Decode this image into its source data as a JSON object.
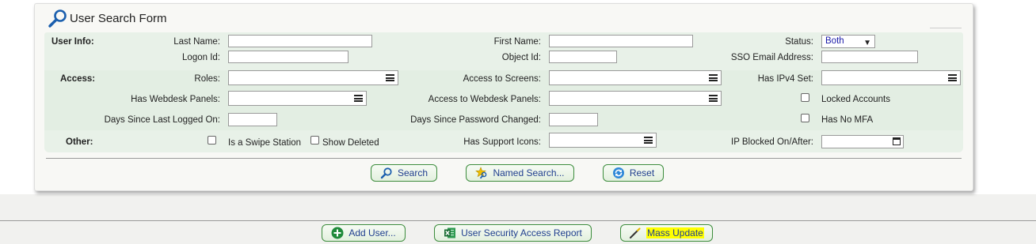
{
  "form": {
    "title": "User Search Form",
    "sections": {
      "user_info": "User Info:",
      "access": "Access:",
      "other": "Other:"
    },
    "fields": {
      "last_name": {
        "label": "Last Name:",
        "value": ""
      },
      "first_name": {
        "label": "First Name:",
        "value": ""
      },
      "status": {
        "label": "Status:",
        "value": "Both"
      },
      "logon_id": {
        "label": "Logon Id:",
        "value": ""
      },
      "object_id": {
        "label": "Object Id:",
        "value": ""
      },
      "sso_email": {
        "label": "SSO Email Address:",
        "value": ""
      },
      "roles": {
        "label": "Roles:"
      },
      "access_screens": {
        "label": "Access to Screens:"
      },
      "has_ipv4": {
        "label": "Has IPv4 Set:"
      },
      "webdesk_panels": {
        "label": "Has Webdesk Panels:"
      },
      "access_webdesk_panels": {
        "label": "Access to Webdesk Panels:"
      },
      "locked_accounts": {
        "label": "Locked Accounts",
        "checked": false
      },
      "days_logged_on": {
        "label": "Days Since Last Logged On:",
        "value": ""
      },
      "days_pw_changed": {
        "label": "Days Since Password Changed:",
        "value": ""
      },
      "has_no_mfa": {
        "label": "Has No MFA",
        "checked": false
      },
      "swipe_station": {
        "label": "Is a Swipe Station",
        "checked": false
      },
      "show_deleted": {
        "label": "Show Deleted",
        "checked": false
      },
      "support_icons": {
        "label": "Has Support Icons:"
      },
      "ip_blocked": {
        "label": "IP Blocked On/After:",
        "value": ""
      }
    },
    "buttons": {
      "search": "Search",
      "named_search": "Named Search...",
      "reset": "Reset"
    }
  },
  "footer_buttons": {
    "add_user": "Add User...",
    "security_report": "User Security Access Report",
    "mass_update": "Mass Update"
  },
  "colors": {
    "accent_green": "#3c8c3c",
    "link_blue": "#203f8f",
    "band_green": "#e8f1e8",
    "highlight": "#ffff00"
  }
}
